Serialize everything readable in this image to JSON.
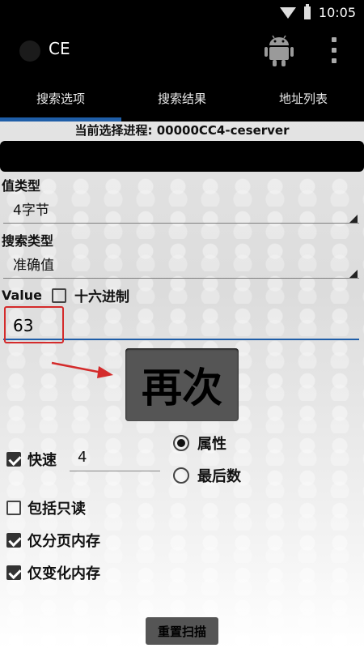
{
  "status_bar": {
    "time": "10:05",
    "icons": [
      "wifi-icon",
      "battery-icon"
    ]
  },
  "app_bar": {
    "title": "CE",
    "icons": [
      "android-icon",
      "overflow-menu-icon"
    ]
  },
  "tabs": [
    {
      "label": "搜索选项",
      "active": true
    },
    {
      "label": "搜索结果",
      "active": false
    },
    {
      "label": "地址列表",
      "active": false
    }
  ],
  "process_label": "当前选择进程: 00000CC4-ceserver",
  "value_type": {
    "label": "值类型",
    "selected": "4字节"
  },
  "search_type": {
    "label": "搜索类型",
    "selected": "准确值"
  },
  "value": {
    "label": "Value",
    "hex_label": "十六进制",
    "hex_checked": false,
    "input": "63"
  },
  "again_button": "再次",
  "quick": {
    "label": "快速",
    "checked": true,
    "value": "4"
  },
  "radios": [
    {
      "label": "属性",
      "selected": true
    },
    {
      "label": "最后数",
      "selected": false
    }
  ],
  "checkboxes": [
    {
      "label": "包括只读",
      "checked": false
    },
    {
      "label": "仅分页内存",
      "checked": true
    },
    {
      "label": "仅变化内存",
      "checked": true
    }
  ],
  "reset_button": "重置扫描",
  "colors": {
    "accent": "#1f5ea8",
    "highlight": "#d42b2b",
    "button": "#555555"
  }
}
